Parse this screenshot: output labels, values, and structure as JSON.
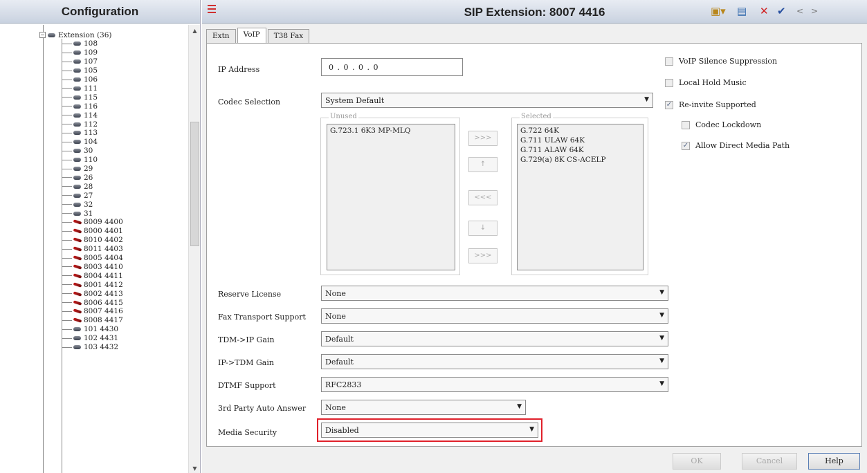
{
  "left_panel": {
    "title": "Configuration",
    "root": {
      "label": "Extension (36)",
      "expander": "−"
    },
    "items": [
      {
        "label": "108",
        "icon": "g"
      },
      {
        "label": "109",
        "icon": "g"
      },
      {
        "label": "107",
        "icon": "g"
      },
      {
        "label": "105",
        "icon": "g"
      },
      {
        "label": "106",
        "icon": "g"
      },
      {
        "label": "111",
        "icon": "g"
      },
      {
        "label": "115",
        "icon": "g"
      },
      {
        "label": "116",
        "icon": "g"
      },
      {
        "label": "114",
        "icon": "g"
      },
      {
        "label": "112",
        "icon": "g"
      },
      {
        "label": "113",
        "icon": "g"
      },
      {
        "label": "104",
        "icon": "g"
      },
      {
        "label": "30",
        "icon": "g"
      },
      {
        "label": "110",
        "icon": "g"
      },
      {
        "label": "29",
        "icon": "g"
      },
      {
        "label": "26",
        "icon": "g"
      },
      {
        "label": "28",
        "icon": "g"
      },
      {
        "label": "27",
        "icon": "g"
      },
      {
        "label": "32",
        "icon": "g"
      },
      {
        "label": "31",
        "icon": "g"
      },
      {
        "label": "8009 4400",
        "icon": "r"
      },
      {
        "label": "8000 4401",
        "icon": "r"
      },
      {
        "label": "8010 4402",
        "icon": "r"
      },
      {
        "label": "8011 4403",
        "icon": "r"
      },
      {
        "label": "8005 4404",
        "icon": "r"
      },
      {
        "label": "8003 4410",
        "icon": "r"
      },
      {
        "label": "8004 4411",
        "icon": "r"
      },
      {
        "label": "8001 4412",
        "icon": "r"
      },
      {
        "label": "8002 4413",
        "icon": "r"
      },
      {
        "label": "8006 4415",
        "icon": "r"
      },
      {
        "label": "8007 4416",
        "icon": "r"
      },
      {
        "label": "8008 4417",
        "icon": "r"
      },
      {
        "label": "101 4430",
        "icon": "g"
      },
      {
        "label": "102 4431",
        "icon": "g"
      },
      {
        "label": "103 4432",
        "icon": "g"
      }
    ]
  },
  "right_panel": {
    "title": "SIP Extension: 8007 4416",
    "tabs": [
      "Extn",
      "VoIP",
      "T38 Fax"
    ],
    "active_tab": "VoIP",
    "ip_address": {
      "label": "IP Address",
      "value": "0  .  0  .  0  .  0"
    },
    "codec_selection": {
      "label": "Codec Selection",
      "value": "System Default"
    },
    "unused": {
      "label": "Unused",
      "items": [
        "G.723.1 6K3 MP-MLQ"
      ]
    },
    "selected": {
      "label": "Selected",
      "items": [
        "G.722 64K",
        "G.711 ULAW 64K",
        "G.711 ALAW 64K",
        "G.729(a) 8K CS-ACELP"
      ]
    },
    "move_buttons": [
      ">>>",
      "↑",
      "<<<",
      "↓",
      ">>>"
    ],
    "fields": [
      {
        "label": "Reserve License",
        "value": "None"
      },
      {
        "label": "Fax Transport Support",
        "value": "None"
      },
      {
        "label": "TDM->IP Gain",
        "value": "Default"
      },
      {
        "label": "IP->TDM Gain",
        "value": "Default"
      },
      {
        "label": "DTMF Support",
        "value": "RFC2833"
      },
      {
        "label": "3rd Party Auto Answer",
        "value": "None"
      },
      {
        "label": "Media Security",
        "value": "Disabled"
      }
    ],
    "checkboxes": [
      {
        "label": "VoIP Silence Suppression",
        "checked": false
      },
      {
        "label": "Local Hold Music",
        "checked": false
      },
      {
        "label": "Re-invite Supported",
        "checked": true
      },
      {
        "label": "Codec Lockdown",
        "checked": false
      },
      {
        "label": "Allow Direct Media Path",
        "checked": true
      }
    ],
    "buttons": {
      "ok": "OK",
      "cancel": "Cancel",
      "help": "Help"
    }
  }
}
